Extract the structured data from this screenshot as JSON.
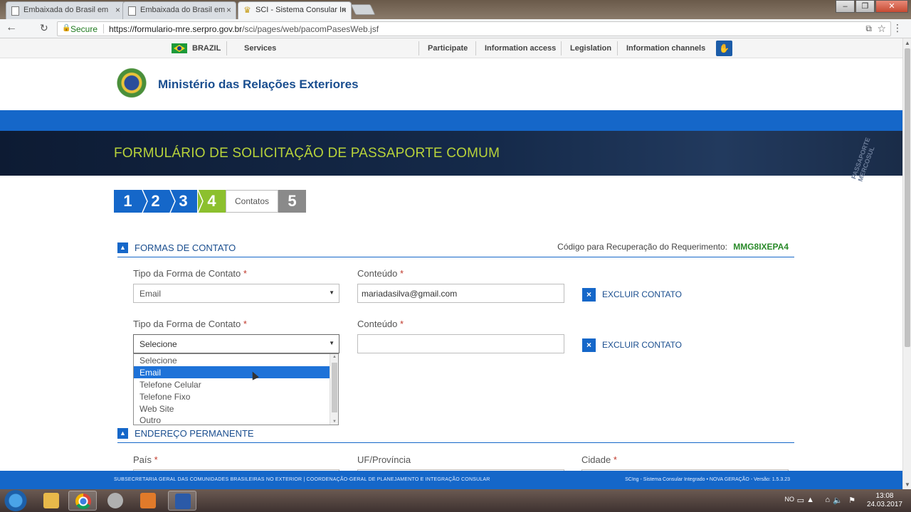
{
  "browser": {
    "tabs": [
      {
        "title": "Embaixada do Brasil em"
      },
      {
        "title": "Embaixada do Brasil em"
      },
      {
        "title": "SCI - Sistema Consular In"
      }
    ],
    "secure_label": "Secure",
    "url_host": "https://formulario-mre.serpro.gov.br",
    "url_path": "/sci/pages/web/pacomPasesWeb.jsf"
  },
  "govbar": {
    "country": "BRAZIL",
    "services": "Services",
    "links": [
      "Participate",
      "Information access",
      "Legislation",
      "Information channels"
    ]
  },
  "header": {
    "ministry": "Ministério das Relações Exteriores",
    "form_title": "FORMULÁRIO DE SOLICITAÇÃO DE PASSAPORTE COMUM",
    "banner_stamp": "PASSAPORTE MERCOSUL"
  },
  "steps": {
    "numbers": [
      "1",
      "2",
      "3",
      "4",
      "5"
    ],
    "current_label": "Contatos"
  },
  "contact_section": {
    "title": "FORMAS DE CONTATO",
    "recovery_label": "Código para Recuperação do Requerimento:",
    "recovery_code": "MMG8IXEPA4",
    "type_label": "Tipo da Forma de Contato",
    "content_label": "Conteúdo",
    "required_mark": "*",
    "delete_label": "EXCLUIR CONTATO",
    "rows": [
      {
        "type": "Email",
        "content": ""
      },
      {
        "type": "Selecione",
        "content": ""
      }
    ],
    "first_content": "mariadasilva@gmail.com",
    "dropdown_options": [
      "Selecione",
      "Email",
      "Telefone Celular",
      "Telefone Fixo",
      "Web Site",
      "Outro"
    ],
    "highlighted_option": "Email"
  },
  "address_section": {
    "title": "ENDEREÇO PERMANENTE",
    "country_label": "País",
    "state_label": "UF/Província",
    "city_label": "Cidade"
  },
  "footer": {
    "left": "SUBSECRETARIA GERAL DAS COMUNIDADES BRASILEIRAS NO EXTERIOR | COORDENAÇÃO-GERAL DE PLANEJAMENTO E INTEGRAÇÃO CONSULAR",
    "right": "SCIng - Sistema Consular Integrado • NOVA GERAÇÃO - Versão: 1.5.3.23"
  },
  "taskbar": {
    "lang": "NO",
    "time": "13:08",
    "date": "24.03.2017"
  },
  "colors": {
    "primary_blue": "#1567c9",
    "step_current": "#8cc02e",
    "title_green": "#b8d33a",
    "code_green": "#2a8a2a"
  }
}
